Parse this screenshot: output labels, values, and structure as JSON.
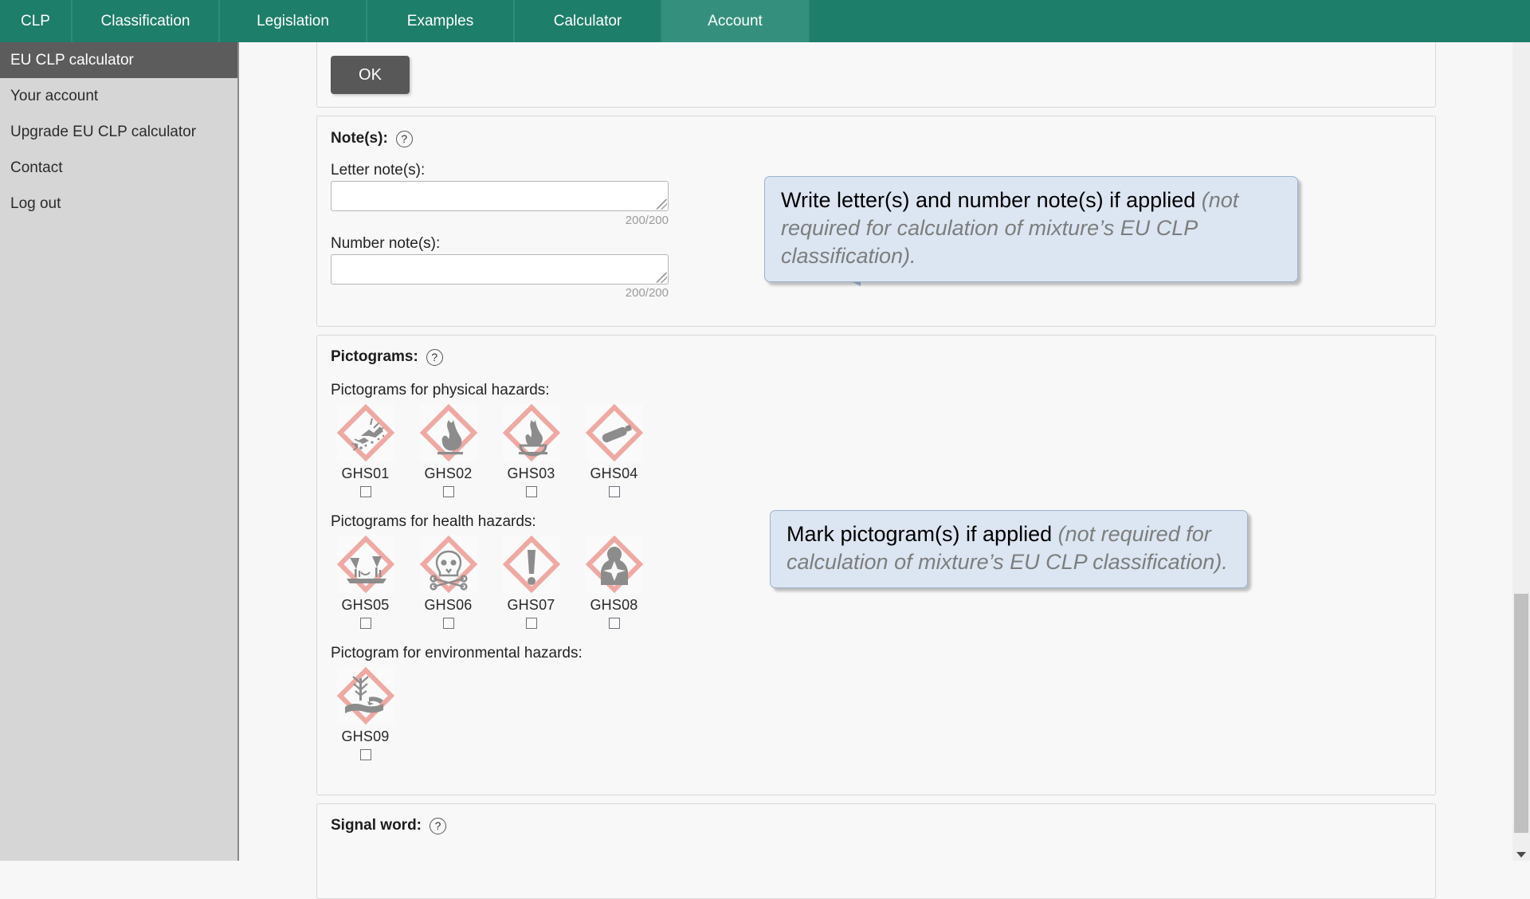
{
  "navbar": {
    "tabs": [
      {
        "label": "CLP",
        "active": false
      },
      {
        "label": "Classification",
        "active": false
      },
      {
        "label": "Legislation",
        "active": false
      },
      {
        "label": "Examples",
        "active": false
      },
      {
        "label": "Calculator",
        "active": false
      },
      {
        "label": "Account",
        "active": true
      }
    ],
    "active_color": "#34907c",
    "background_color": "#1d7e69"
  },
  "sidebar": {
    "items": [
      {
        "label": "EU CLP calculator",
        "active": true
      },
      {
        "label": "Your account",
        "active": false
      },
      {
        "label": "Upgrade EU CLP calculator",
        "active": false
      },
      {
        "label": "Contact",
        "active": false
      },
      {
        "label": "Log out",
        "active": false
      }
    ],
    "active_background": "#5c5c5c",
    "background_color": "#d6d6d6"
  },
  "ok_panel": {
    "button_label": "OK"
  },
  "notes": {
    "title": "Note(s):",
    "help_icon": "question-mark-icon",
    "letter_label": "Letter note(s):",
    "letter_value": "",
    "letter_counter": "200/200",
    "number_label": "Number note(s):",
    "number_value": "",
    "number_counter": "200/200"
  },
  "pictograms": {
    "title": "Pictograms:",
    "help_icon": "question-mark-icon",
    "group_physical_label": "Pictograms for physical hazards:",
    "group_health_label": "Pictograms for health hazards:",
    "group_environment_label": "Pictogram for environmental hazards:",
    "physical": [
      {
        "code": "GHS01",
        "symbol": "exploding-bomb-icon",
        "checked": false
      },
      {
        "code": "GHS02",
        "symbol": "flame-icon",
        "checked": false
      },
      {
        "code": "GHS03",
        "symbol": "flame-over-circle-icon",
        "checked": false
      },
      {
        "code": "GHS04",
        "symbol": "gas-cylinder-icon",
        "checked": false
      }
    ],
    "health": [
      {
        "code": "GHS05",
        "symbol": "corrosion-icon",
        "checked": false
      },
      {
        "code": "GHS06",
        "symbol": "skull-and-crossbones-icon",
        "checked": false
      },
      {
        "code": "GHS07",
        "symbol": "exclamation-mark-icon",
        "checked": false
      },
      {
        "code": "GHS08",
        "symbol": "health-hazard-icon",
        "checked": false
      }
    ],
    "environment": [
      {
        "code": "GHS09",
        "symbol": "environment-icon",
        "checked": false
      }
    ],
    "diamond_color": "#efa9a2",
    "symbol_color": "#8c8c8c"
  },
  "signal_word": {
    "title": "Signal word:",
    "help_icon": "question-mark-icon"
  },
  "callouts": [
    {
      "id": "notes-callout",
      "bold_text": "Write letter(s) and number note(s) if applied ",
      "muted_text": "(not required for calculation of mixture’s EU CLP classification).",
      "background_color": "#dce6f2"
    },
    {
      "id": "pictograms-callout",
      "bold_text": "Mark pictogram(s) if applied ",
      "muted_text": "(not required for calculation of mixture’s EU CLP classification).",
      "background_color": "#dce6f2"
    }
  ],
  "scrollbar": {
    "thumb_color": "#c0c0c0",
    "down_arrow_icon": "chevron-down-icon"
  }
}
